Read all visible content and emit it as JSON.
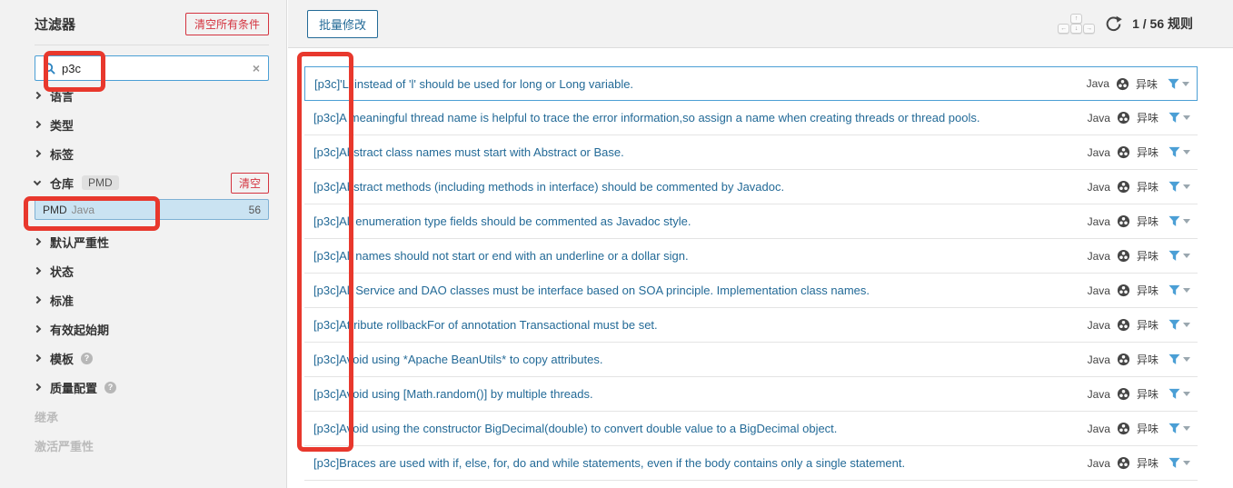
{
  "colors": {
    "accent_blue": "#4b9fd5",
    "link_blue": "#236a97",
    "danger_red": "#d4333f",
    "annotation_red": "#e8382d",
    "selected_facet_bg": "#cae3f2",
    "panel_gray": "#f2f2f2"
  },
  "icons": {
    "search": "magnifier-icon",
    "clear_x": "×",
    "help": "?",
    "code_smell": "code-smell-icon",
    "filter": "funnel-icon",
    "refresh": "reload-circular-arrow"
  },
  "sidebar": {
    "title": "过滤器",
    "clear_all_label": "清空所有条件",
    "search": {
      "value": "p3c"
    },
    "sections": [
      {
        "label": "语言"
      },
      {
        "label": "类型"
      },
      {
        "label": "标签"
      },
      {
        "label": "仓库",
        "badge": "PMD",
        "clear_label": "清空",
        "expanded": true
      },
      {
        "label": "默认严重性"
      },
      {
        "label": "状态"
      },
      {
        "label": "标准"
      },
      {
        "label": "有效起始期"
      },
      {
        "label": "模板",
        "has_help": true
      },
      {
        "label": "质量配置",
        "has_help": true
      }
    ],
    "repo_facet": {
      "repo": "PMD",
      "language": "Java",
      "count": "56",
      "selected": true
    },
    "disabled": [
      "继承",
      "激活严重性"
    ]
  },
  "toolbar": {
    "bulk_change_label": "批量修改",
    "keypad": {
      "up": "↑",
      "left": "←",
      "down": "↓",
      "right": "→"
    },
    "rule_count": "1 / 56 规则"
  },
  "rules": [
    {
      "title": "[p3c]'L' instead of 'l' should be used for long or Long variable.",
      "language": "Java",
      "type": "异味",
      "selected": true
    },
    {
      "title": "[p3c]A meaningful thread name is helpful to trace the error information,so assign a name when creating threads or thread pools.",
      "language": "Java",
      "type": "异味"
    },
    {
      "title": "[p3c]Abstract class names must start with Abstract or Base.",
      "language": "Java",
      "type": "异味"
    },
    {
      "title": "[p3c]Abstract methods (including methods in interface) should be commented by Javadoc.",
      "language": "Java",
      "type": "异味"
    },
    {
      "title": "[p3c]All enumeration type fields should be commented as Javadoc style.",
      "language": "Java",
      "type": "异味"
    },
    {
      "title": "[p3c]All names should not start or end with an underline or a dollar sign.",
      "language": "Java",
      "type": "异味"
    },
    {
      "title": "[p3c]All Service and DAO classes must be interface based on SOA principle. Implementation class names.",
      "language": "Java",
      "type": "异味"
    },
    {
      "title": "[p3c]Attribute rollbackFor of annotation Transactional must be set.",
      "language": "Java",
      "type": "异味"
    },
    {
      "title": "[p3c]Avoid using *Apache BeanUtils* to copy attributes.",
      "language": "Java",
      "type": "异味"
    },
    {
      "title": "[p3c]Avoid using [Math.random()] by multiple threads.",
      "language": "Java",
      "type": "异味"
    },
    {
      "title": "[p3c]Avoid using the constructor BigDecimal(double) to convert double value to a BigDecimal object.",
      "language": "Java",
      "type": "异味"
    },
    {
      "title": "[p3c]Braces are used with if, else, for, do and while statements, even if the body contains only a single statement.",
      "language": "Java",
      "type": "异味"
    }
  ]
}
